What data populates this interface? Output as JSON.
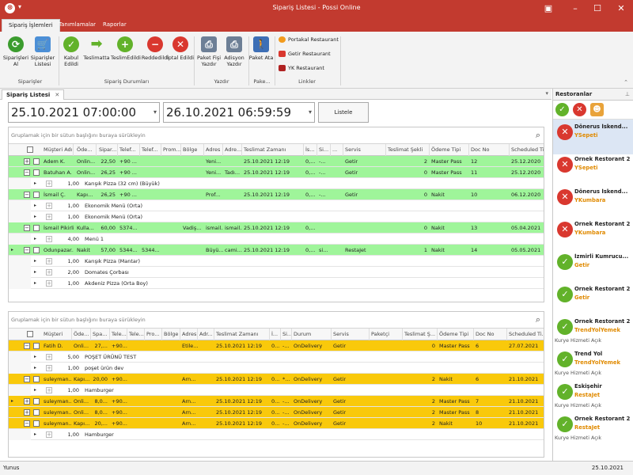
{
  "window": {
    "title": "Sipariş Listesi - Possi Online"
  },
  "ribbon_tabs": [
    "Sipariş İşlemleri",
    "Tanımlamalar",
    "Raporlar"
  ],
  "ribbon": {
    "buttons": [
      {
        "label": "Siparişleri Al"
      },
      {
        "label": "Siparişler Listesi"
      },
      {
        "label": "Kabul Edildi"
      },
      {
        "label": "Teslimatta"
      },
      {
        "label": "TeslimEdildi"
      },
      {
        "label": "Reddedildi"
      },
      {
        "label": "İptal Edildi"
      },
      {
        "label": "Paket Fişi Yazdır"
      },
      {
        "label": "Adisyon Yazdır"
      },
      {
        "label": "Paket Ata"
      }
    ],
    "groups": [
      "Siparişler",
      "Sipariş Durumları",
      "Yazdır",
      "Pake...",
      "Linkler"
    ],
    "links": [
      "Portakal Restaurant",
      "Getir Restaurant",
      "YK Restaurant"
    ]
  },
  "doc_tab": "Sipariş Listesi",
  "filter": {
    "start": "25.10.2021 07:00:00",
    "end": "26.10.2021 06:59:59",
    "list_button": "Listele"
  },
  "group_hint": "Gruplamak için bir sütun başlığını buraya sürükleyin",
  "grid1": {
    "headers": [
      "Müşteri Adı",
      "Öde...",
      "Sipar...",
      "Telef...",
      "Telef...",
      "Prom...",
      "Bölge",
      "Adres",
      "Adre...",
      "Teslimat Zamanı",
      "İs...",
      "Si...",
      "...",
      "Servis",
      "Teslimat Şekli",
      "Ödeme Tipi",
      "Doc No",
      "Scheduled Time"
    ],
    "rows": [
      {
        "kind": "main",
        "cells": [
          "Adem K.",
          "Onlin...",
          "22,50",
          "+90 ...",
          "",
          "",
          "",
          "Yeni...",
          "",
          "25.10.2021 12:19",
          "0,...",
          "-...",
          "",
          "Getir",
          "2",
          "Master Pass",
          "12",
          "25.12.2020"
        ]
      },
      {
        "kind": "main",
        "cells": [
          "Batuhan A.",
          "Onlin...",
          "26,25",
          "+90 ...",
          "",
          "",
          "",
          "Yeni...",
          "Tadı...",
          "25.10.2021 12:19",
          "0,...",
          "-...",
          "",
          "Getir",
          "0",
          "Master Pass",
          "11",
          "25.12.2020"
        ]
      },
      {
        "kind": "sub",
        "qty": "1,00",
        "name": "Karışık Pizza (32 cm) (Büyük)"
      },
      {
        "kind": "main",
        "cells": [
          "İsmail Ç.",
          "Kapı...",
          "26,25",
          "+90 ...",
          "",
          "",
          "",
          "Prof...",
          "",
          "25.10.2021 12:19",
          "0,...",
          "-...",
          "",
          "Getir",
          "0",
          "Nakit",
          "10",
          "06.12.2020"
        ]
      },
      {
        "kind": "sub",
        "qty": "1,00",
        "name": "Ekonomik Menü (Orta)"
      },
      {
        "kind": "sub",
        "qty": "1,00",
        "name": "Ekonomik Menü (Orta)"
      },
      {
        "kind": "main",
        "cells": [
          "İsmail Pikirli",
          "Kulla...",
          "60,00",
          "5374...",
          "",
          "",
          "Vadiş...",
          "ismail...",
          "ismail...",
          "25.10.2021 12:19",
          "0,...",
          "",
          "",
          "",
          "0",
          "Nakit",
          "13",
          "05.04.2021"
        ]
      },
      {
        "kind": "sub",
        "qty": "4,00",
        "name": "Menü 1"
      },
      {
        "kind": "main",
        "cells": [
          "Odunpazar...",
          "Nakit",
          "57,00",
          "5344...",
          "5344...",
          "",
          "",
          "Büyü...",
          "cami...",
          "25.10.2021 12:19",
          "0,...",
          "si...",
          "",
          "RestaJet",
          "1",
          "Nakit",
          "14",
          "05.05.2021"
        ]
      },
      {
        "kind": "sub",
        "qty": "1,00",
        "name": "Karışık Pizza (Mantar)"
      },
      {
        "kind": "sub",
        "qty": "2,00",
        "name": "Domates Çorbası"
      },
      {
        "kind": "sub",
        "qty": "1,00",
        "name": "Akdeniz Pizza (Orta Boy)"
      }
    ]
  },
  "grid2": {
    "headers": [
      "Müşteri",
      "Öde...",
      "Spa...",
      "Tele...",
      "Tele...",
      "Pro...",
      "Bölge",
      "Adres",
      "Adr...",
      "Teslimat Zamanı",
      "İ...",
      "Si...",
      "Durum",
      "Servis",
      "Paketçi",
      "Teslimat Ş...",
      "Ödeme Tipi",
      "Doc No",
      "Scheduled Ti..."
    ],
    "rows": [
      {
        "kind": "main",
        "cells": [
          "Fatih D.",
          "Onli...",
          "27,...",
          "+90...",
          "",
          "",
          "",
          "Etile...",
          "",
          "25.10.2021 12:19",
          "0...",
          "-...",
          "OnDelivery",
          "Getir",
          "",
          "0",
          "Master Pass",
          "6",
          "27.07.2021"
        ]
      },
      {
        "kind": "sub",
        "qty": "5,00",
        "name": "POŞET ÜRÜNÜ TEST"
      },
      {
        "kind": "sub",
        "qty": "1,00",
        "name": "poşet ürün dev"
      },
      {
        "kind": "main",
        "cells": [
          "suleyman...",
          "Kapı...",
          "20,00",
          "+90...",
          "",
          "",
          "",
          "Arn...",
          "",
          "25.10.2021 12:19",
          "0...",
          "*...",
          "OnDelivery",
          "Getir",
          "",
          "2",
          "Nakit",
          "6",
          "21.10.2021"
        ]
      },
      {
        "kind": "sub",
        "qty": "1,00",
        "name": "Hamburger"
      },
      {
        "kind": "main",
        "cells": [
          "suleyman...",
          "Onli...",
          "8,0...",
          "+90...",
          "",
          "",
          "",
          "Arn...",
          "",
          "25.10.2021 12:19",
          "0...",
          "-...",
          "OnDelivery",
          "Getir",
          "",
          "2",
          "Master Pass",
          "7",
          "21.10.2021"
        ]
      },
      {
        "kind": "main",
        "cells": [
          "suleyman...",
          "Onli...",
          "8,0...",
          "+90...",
          "",
          "",
          "",
          "Arn...",
          "",
          "25.10.2021 12:19",
          "0...",
          "-...",
          "OnDelivery",
          "Getir",
          "",
          "2",
          "Master Pass",
          "8",
          "21.10.2021"
        ]
      },
      {
        "kind": "main",
        "cells": [
          "suleyman...",
          "Kapı...",
          "20,...",
          "+90...",
          "",
          "",
          "",
          "Arn...",
          "",
          "25.10.2021 12:19",
          "0...",
          "-...",
          "OnDelivery",
          "Getir",
          "",
          "2",
          "Nakit",
          "10",
          "21.10.2021"
        ]
      },
      {
        "kind": "sub",
        "qty": "1,00",
        "name": "Hamburger"
      }
    ]
  },
  "restaurants": {
    "title": "Restoranlar",
    "items": [
      {
        "name": "Dönerus İskend...",
        "service": "YSepeti",
        "status": "red",
        "note": ""
      },
      {
        "name": "Ornek Restorant 2",
        "service": "YSepeti",
        "status": "red",
        "note": ""
      },
      {
        "name": "Dönerus İskend...",
        "service": "YKumbara",
        "status": "red",
        "note": ""
      },
      {
        "name": "Ornek Restorant 2",
        "service": "YKumbara",
        "status": "red",
        "note": ""
      },
      {
        "name": "İzmirli Kumrucu...",
        "service": "Getir",
        "status": "green",
        "note": ""
      },
      {
        "name": "Ornek Restorant 2",
        "service": "Getir",
        "status": "green",
        "note": ""
      },
      {
        "name": "Ornek Restorant 2",
        "service": "TrendYolYemek",
        "status": "green",
        "note": "Kurye Hizmeti Açık"
      },
      {
        "name": "Trend Yol",
        "service": "TrendYolYemek",
        "status": "green",
        "note": "Kurye Hizmeti Açık"
      },
      {
        "name": "Eskişehir",
        "service": "RestaJet",
        "status": "green",
        "note": "Kurye Hizmeti Açık"
      },
      {
        "name": "Ornek Restorant 2",
        "service": "RestaJet",
        "status": "green",
        "note": "Kurye Hizmeti Açık"
      }
    ]
  },
  "status": {
    "user": "Yunus",
    "date": "25.10.2021"
  }
}
